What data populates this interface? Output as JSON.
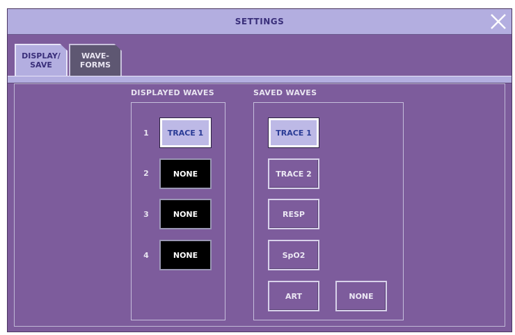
{
  "window": {
    "title": "SETTINGS"
  },
  "tabs": [
    {
      "label": "DISPLAY/\nSAVE",
      "active": true
    },
    {
      "label": "WAVE-\nFORMS",
      "active": false
    }
  ],
  "displayed_waves": {
    "title": "DISPLAYED WAVES",
    "rows": [
      {
        "number": "1",
        "value": "TRACE 1"
      },
      {
        "number": "2",
        "value": "NONE"
      },
      {
        "number": "3",
        "value": "NONE"
      },
      {
        "number": "4",
        "value": "NONE"
      }
    ]
  },
  "saved_waves": {
    "title": "SAVED WAVES",
    "buttons": [
      "TRACE 1",
      "TRACE 2",
      "RESP",
      "SpO2",
      "ART",
      "NONE"
    ]
  },
  "colors": {
    "background": "#7d5c9c",
    "titlebar": "#b3aee0",
    "selected": "#bdb9e6",
    "selected_text": "#2b3c96"
  },
  "icons": {
    "close": "close-icon"
  }
}
